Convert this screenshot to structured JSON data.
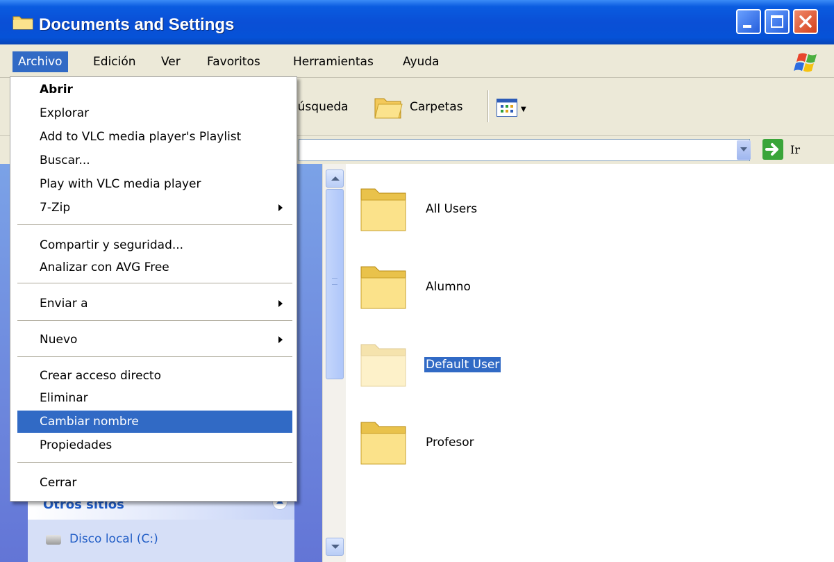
{
  "window": {
    "title": "Documents and Settings"
  },
  "menubar": {
    "items": [
      "Archivo",
      "Edición",
      "Ver",
      "Favoritos",
      "Herramientas",
      "Ayuda"
    ],
    "active": "Archivo"
  },
  "toolbar": {
    "search_label": "Búsqueda",
    "folders_label": "Carpetas"
  },
  "addressbar": {
    "go_label": "Ir"
  },
  "file_menu": {
    "items": [
      {
        "label": "Abrir",
        "bold": true
      },
      {
        "label": "Explorar"
      },
      {
        "label": "Add to VLC media player's Playlist"
      },
      {
        "label": "Buscar..."
      },
      {
        "label": "Play with VLC media player"
      },
      {
        "label": "7-Zip",
        "submenu": true
      },
      {
        "label": "Compartir y seguridad..."
      },
      {
        "label": "Analizar con AVG Free"
      },
      {
        "label": "Enviar a",
        "submenu": true
      },
      {
        "label": "Nuevo",
        "submenu": true
      },
      {
        "label": "Crear acceso directo"
      },
      {
        "label": "Eliminar"
      },
      {
        "label": "Cambiar nombre",
        "highlighted": true
      },
      {
        "label": "Propiedades"
      },
      {
        "label": "Cerrar"
      }
    ]
  },
  "left_panel": {
    "other_places_title": "Otros sitios",
    "items": [
      {
        "label": "Disco local (C:)",
        "icon": "hard-drive-icon"
      }
    ]
  },
  "folders": [
    {
      "name": "All Users",
      "selected": false
    },
    {
      "name": "Alumno",
      "selected": false
    },
    {
      "name": "Default User",
      "selected": true
    },
    {
      "name": "Profesor",
      "selected": false
    }
  ],
  "colors": {
    "titlebar": "#0a4fd6",
    "selection": "#316ac5",
    "chrome": "#ece9d8",
    "task_pane": "#d6dff7"
  }
}
